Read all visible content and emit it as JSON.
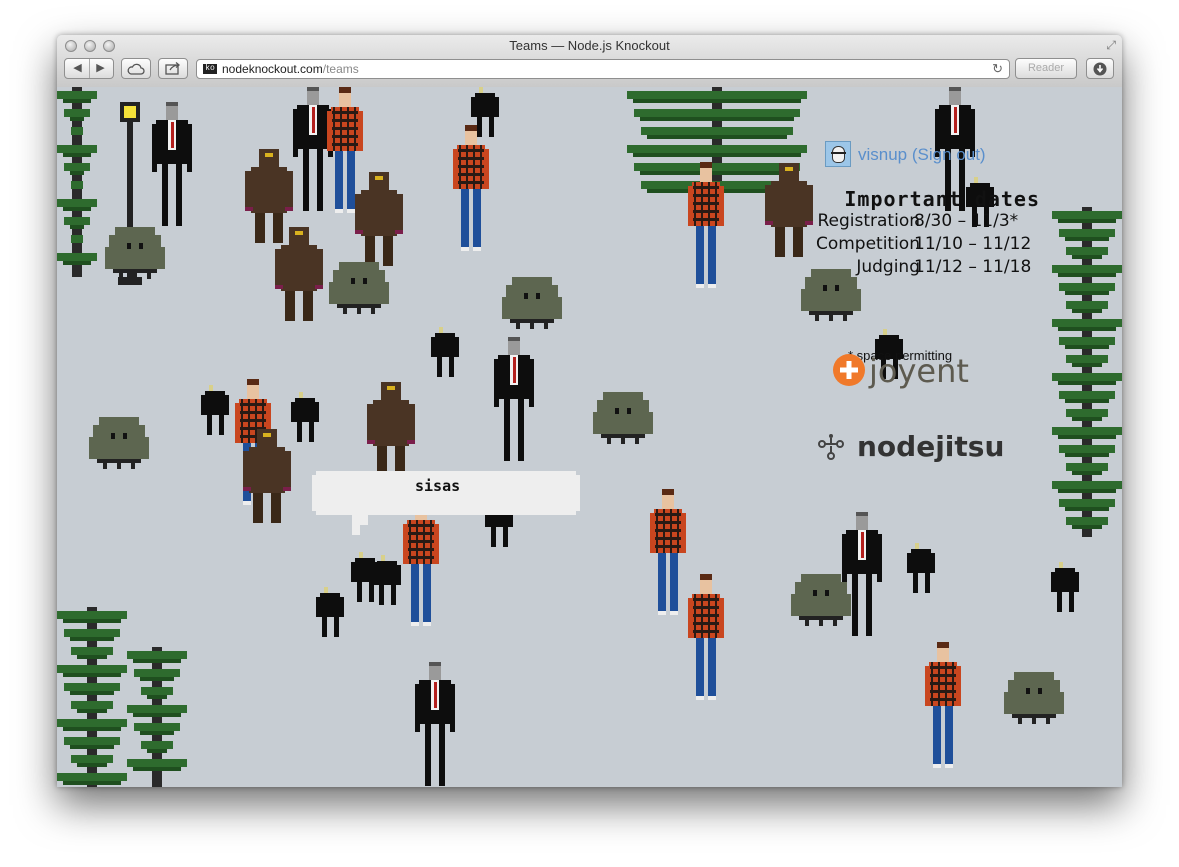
{
  "window": {
    "title": "Teams — Node.js Knockout",
    "reader_label": "Reader"
  },
  "address_bar": {
    "favicon_text": "ko",
    "domain": "nodeknockout.com",
    "path": "/teams"
  },
  "user": {
    "name": "visnup",
    "sign_out_label": "(Sign out)"
  },
  "important_dates": {
    "heading": "Important dates",
    "rows": [
      {
        "label": "Registration",
        "value": "8/30 – 11/3*"
      },
      {
        "label": "Competition",
        "value": "11/10 – 11/12"
      },
      {
        "label": "Judging",
        "value": "11/12 – 11/18"
      }
    ],
    "footnote": "* space permitting"
  },
  "sponsors": [
    "joyent",
    "nodejitsu"
  ],
  "speech_bubble": {
    "text": "sisas"
  },
  "colors": {
    "background": "#c7cdd3",
    "link": "#5a8fcc",
    "joyent_orange": "#f0792a",
    "tree_green": "#2e6b2e"
  },
  "icons": [
    "back-arrow-icon",
    "forward-arrow-icon",
    "cloud-icon",
    "share-icon",
    "reload-icon",
    "download-icon",
    "resize-icon"
  ]
}
